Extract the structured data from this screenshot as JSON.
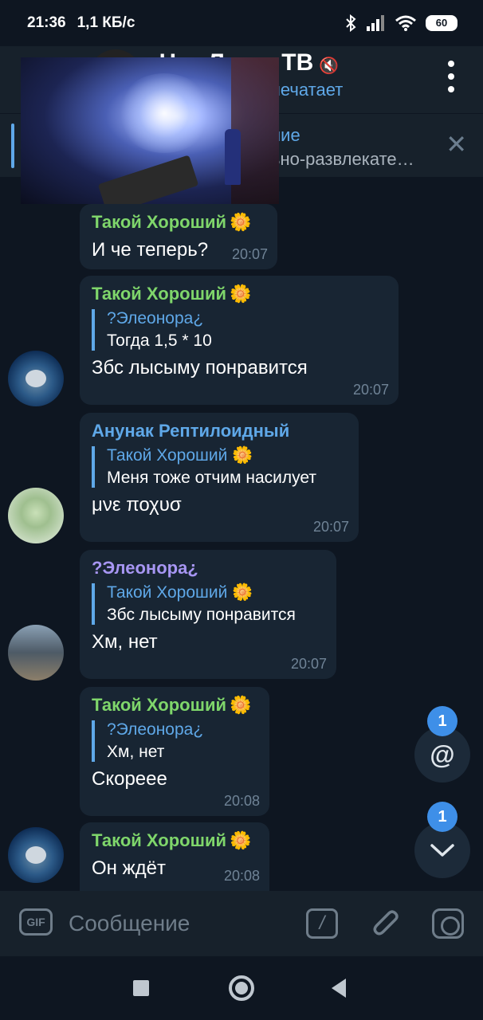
{
  "status": {
    "time": "21:36",
    "speed": "1,1 КБ/с",
    "battery": "60"
  },
  "header": {
    "title": "Чат Лиды ТВ",
    "subtitle": "печатает"
  },
  "pinned": {
    "title": "ние",
    "text": "ьно-развлекате…"
  },
  "messages": [
    {
      "sender": "Такой Хороший",
      "flower": "🌼",
      "text": "И че теперь?",
      "time": "20:07"
    },
    {
      "sender": "Такой Хороший",
      "flower": "🌼",
      "reply_name": "?Элеонора¿",
      "reply_text": "Тогда 1,5 * 10",
      "text": "Збс лысыму понравится",
      "time": "20:07"
    },
    {
      "sender": "Анунак Рептилоидный",
      "reply_name": "Такой Хороший 🌼",
      "reply_text": "Меня тоже отчим насилует",
      "text": "μνε ποχυσ",
      "time": "20:07"
    },
    {
      "sender": "?Элеонора¿",
      "reply_name": "Такой Хороший 🌼",
      "reply_text": "Збс лысыму понравится",
      "text": "Хм, нет",
      "time": "20:07"
    },
    {
      "sender": "Такой Хороший",
      "flower": "🌼",
      "reply_name": "?Элеонора¿",
      "reply_text": "Хм, нет",
      "text": "Скореее",
      "time": "20:08"
    },
    {
      "sender": "Такой Хороший",
      "flower": "🌼",
      "text": "Он ждёт",
      "time": "20:08"
    }
  ],
  "fabs": {
    "mention_badge": "1",
    "scroll_badge": "1",
    "mention_icon": "@"
  },
  "input": {
    "placeholder": "Сообщение",
    "gif_label": "GIF",
    "command_label": "/"
  },
  "colors": {
    "green_name": "#7fd66b",
    "blue_name": "#5fa8e8",
    "purple_name": "#a796f3",
    "bubble": "#182533",
    "background": "#0e1621"
  }
}
